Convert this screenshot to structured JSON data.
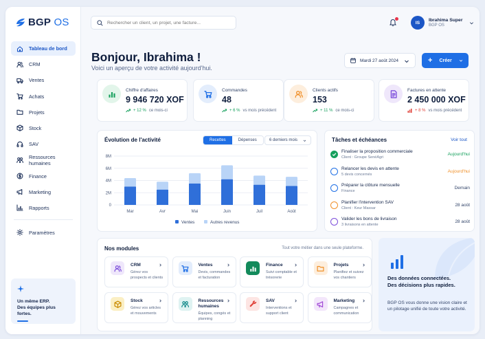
{
  "brand": {
    "name_bold": "BGP",
    "name_light": " OS"
  },
  "sidebar": {
    "items": [
      {
        "label": "Tableau de bord",
        "icon": "home-icon",
        "active": true
      },
      {
        "label": "CRM",
        "icon": "users-icon"
      },
      {
        "label": "Ventes",
        "icon": "truck-icon"
      },
      {
        "label": "Achats",
        "icon": "cart-icon"
      },
      {
        "label": "Projets",
        "icon": "folder-icon"
      },
      {
        "label": "Stock",
        "icon": "box-icon"
      },
      {
        "label": "SAV",
        "icon": "headset-icon"
      },
      {
        "label": "Ressources humaines",
        "icon": "people-icon"
      },
      {
        "label": "Finance",
        "icon": "coin-icon"
      },
      {
        "label": "Marketing",
        "icon": "megaphone-icon"
      },
      {
        "label": "Rapports",
        "icon": "chart-icon"
      }
    ],
    "settings_label": "Paramètres",
    "card_line1": "Un même ERP.",
    "card_line2": "Des équipes plus fortes."
  },
  "topbar": {
    "search_placeholder": "Rechercher un client, un projet, une facture...",
    "user_initials": "IS",
    "user_name": "Ibrahima Super",
    "user_org": "BGP OS"
  },
  "header": {
    "greeting": "Bonjour, Ibrahima !",
    "subtitle": "Voici un aperçu de votre activité aujourd'hui.",
    "date": "Mardi 27 août 2024",
    "create_label": "Créer"
  },
  "kpis": [
    {
      "label": "Chiffre d'affaires",
      "value": "9 946 720 XOF",
      "trend": "+ 12 %",
      "trend_dir": "up",
      "compare": "ce mois-ci",
      "icon": "bar-chart-icon",
      "color": "#16a05d",
      "bg": "#e2f5ea"
    },
    {
      "label": "Commandes",
      "value": "48",
      "trend": "+ 6 %",
      "trend_dir": "up",
      "compare": "vs mois précédent",
      "icon": "cart-icon",
      "color": "#1f6fe5",
      "bg": "#e3edfc"
    },
    {
      "label": "Clients actifs",
      "value": "153",
      "trend": "+ 11 %",
      "trend_dir": "up",
      "compare": "ce mois-ci",
      "icon": "users-icon",
      "color": "#f0902a",
      "bg": "#fdeedd"
    },
    {
      "label": "Factures en attente",
      "value": "2 450 000 XOF",
      "trend": "+ 8 %",
      "trend_dir": "down",
      "compare": "vs mois précédent",
      "icon": "invoice-icon",
      "color": "#7c4ddb",
      "bg": "#efe7fb"
    }
  ],
  "activity": {
    "title": "Évolution de l'activité",
    "tab_recettes": "Recettes",
    "tab_depenses": "Dépenses",
    "period": "6 derniers mois"
  },
  "chart_data": {
    "type": "bar",
    "categories": [
      "Mar",
      "Avr",
      "Mai",
      "Juin",
      "Juil",
      "Août"
    ],
    "series": [
      {
        "name": "Ventes",
        "values": [
          3.0,
          2.5,
          3.5,
          4.2,
          3.3,
          3.1
        ]
      },
      {
        "name": "Autres revenus",
        "values": [
          1.4,
          1.3,
          1.7,
          2.3,
          1.5,
          1.5
        ]
      }
    ],
    "stacked": true,
    "yticks": [
      "0",
      "2M",
      "4M",
      "6M",
      "8M"
    ],
    "ylim": [
      0,
      8
    ],
    "grid": true,
    "legend": "bottom",
    "colors": [
      "#2f6fd9",
      "#b9d4f7"
    ]
  },
  "tasks": {
    "title": "Tâches et échéances",
    "see_all": "Voir tout",
    "items": [
      {
        "title": "Finaliser la proposition commerciale",
        "sub": "Client : Groupe SenéAgri",
        "due": "Aujourd'hui",
        "due_color": "#16a05d",
        "state": "done"
      },
      {
        "title": "Relancer les devis en attente",
        "sub": "5 devis concernés",
        "due": "Aujourd'hui",
        "due_color": "#f0902a",
        "state": "open"
      },
      {
        "title": "Préparer la clôture mensuelle",
        "sub": "Finance",
        "due": "Demain",
        "due_color": "#33456a",
        "state": "open"
      },
      {
        "title": "Planifier l'intervention SAV",
        "sub": "Client : Keur Massar",
        "due": "28 août",
        "due_color": "#33456a",
        "state": "orange"
      },
      {
        "title": "Valider les bons de livraison",
        "sub": "3 livraisons en attente",
        "due": "28 août",
        "due_color": "#33456a",
        "state": "purple"
      }
    ]
  },
  "modules": {
    "title": "Nos modules",
    "hint": "Tout votre métier dans une seule plateforme.",
    "items": [
      {
        "name": "CRM",
        "desc": "Gérez vos prospects et clients",
        "icon": "users-icon",
        "color": "#7c4ddb",
        "bg": "#efe7fb"
      },
      {
        "name": "Ventes",
        "desc": "Devis, commandes et facturation",
        "icon": "cart-icon",
        "color": "#1f6fe5",
        "bg": "#e3edfc"
      },
      {
        "name": "Finance",
        "desc": "Suivi comptable et trésorerie",
        "icon": "bar-chart-icon",
        "color": "#ffffff",
        "bg": "#138a5b"
      },
      {
        "name": "Projets",
        "desc": "Planifiez et suivez vos chantiers",
        "icon": "folder-icon",
        "color": "#f0902a",
        "bg": "#fdeedd"
      },
      {
        "name": "Stock",
        "desc": "Gérez vos articles et mouvements",
        "icon": "box-icon",
        "color": "#c98a00",
        "bg": "#fbefc4"
      },
      {
        "name": "Ressources humaines",
        "desc": "Équipes, congés et planning",
        "icon": "people-icon",
        "color": "#138a8a",
        "bg": "#dff3f2"
      },
      {
        "name": "SAV",
        "desc": "Interventions et support client",
        "icon": "wrench-icon",
        "color": "#e0423a",
        "bg": "#fde5e3"
      },
      {
        "name": "Marketing",
        "desc": "Campagnes et communication",
        "icon": "megaphone-icon",
        "color": "#a24ad6",
        "bg": "#f3e6fb"
      }
    ]
  },
  "promo": {
    "line1": "Des données connectées.",
    "line2": "Des décisions plus rapides.",
    "body": "BGP OS vous donne une vision claire et un pilotage unifié de toute votre activité."
  }
}
